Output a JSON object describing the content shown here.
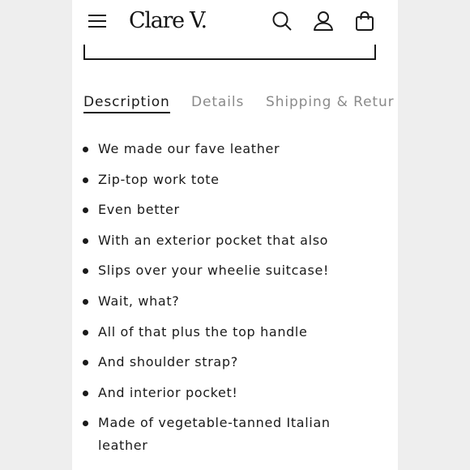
{
  "header": {
    "logo": "Clare V.",
    "icons": [
      "menu-icon",
      "search-icon",
      "account-icon",
      "bag-icon"
    ]
  },
  "tabs": [
    {
      "label": "Description",
      "active": true
    },
    {
      "label": "Details",
      "active": false
    },
    {
      "label": "Shipping & Retur",
      "active": false
    }
  ],
  "description": {
    "bullets": [
      "We made our fave leather",
      "Zip-top work tote",
      "Even better",
      "With an exterior pocket that also",
      "Slips over your wheelie suitcase!",
      "Wait, what?",
      "All of that plus the top handle",
      "And shoulder strap?",
      "And interior pocket!",
      "Made of vegetable-tanned Italian leather"
    ]
  },
  "colors": {
    "text": "#1a1a1a",
    "inactive_tab": "#8a8a8a",
    "background": "#ffffff",
    "outer_background": "#eeeeee"
  }
}
